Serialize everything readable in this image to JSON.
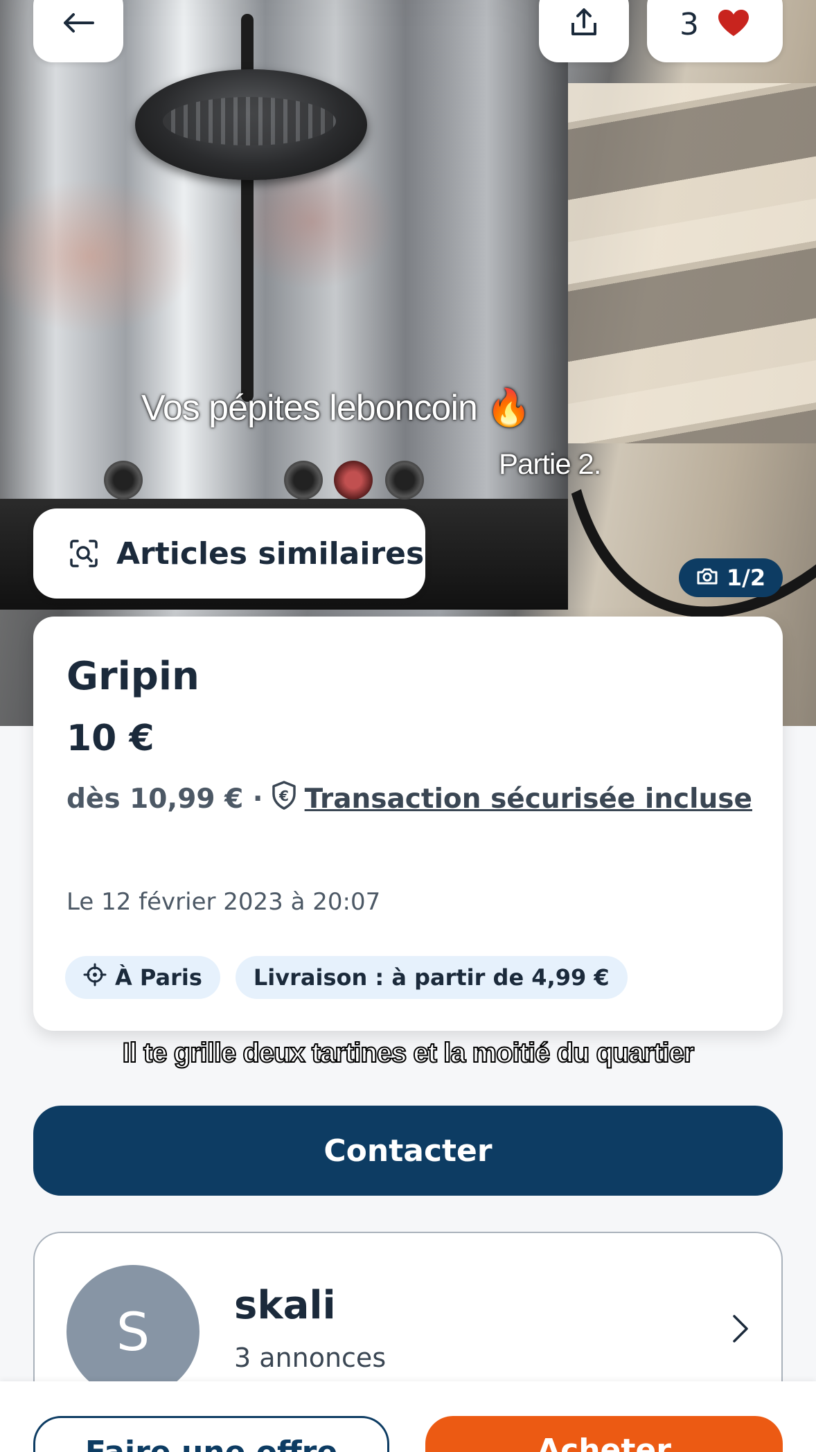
{
  "header": {
    "favorites_count": "3"
  },
  "photo": {
    "caption_title": "Vos pépites leboncoin 🔥",
    "caption_subtitle": "Partie 2.",
    "counter": "1/2"
  },
  "similar": {
    "label": "Articles similaires"
  },
  "listing": {
    "title": "Gripin",
    "price": "10 €",
    "secure_prefix": "dès 10,99 € ·",
    "secure_link": "Transaction sécurisée incluse",
    "date": "Le 12 février 2023 à 20:07",
    "tags": [
      "À Paris",
      "Livraison : à partir de 4,99 €"
    ]
  },
  "video_caption": "Il te grille deux tartines et la moitié du quartier",
  "contact_label": "Contacter",
  "seller": {
    "initial": "S",
    "name": "skali",
    "listings_count": "3 annonces"
  },
  "bottom_bar": {
    "offer_label": "Faire une offre",
    "buy_label": "Acheter"
  },
  "colors": {
    "primary": "#0d3c63",
    "accent": "#ec5a13",
    "heart": "#c8241e",
    "chip_bg": "#e6f1fc"
  },
  "icons": [
    "back-arrow-icon",
    "share-icon",
    "heart-icon",
    "search-image-icon",
    "camera-icon",
    "euro-shield-icon",
    "location-target-icon",
    "chevron-right-icon"
  ]
}
